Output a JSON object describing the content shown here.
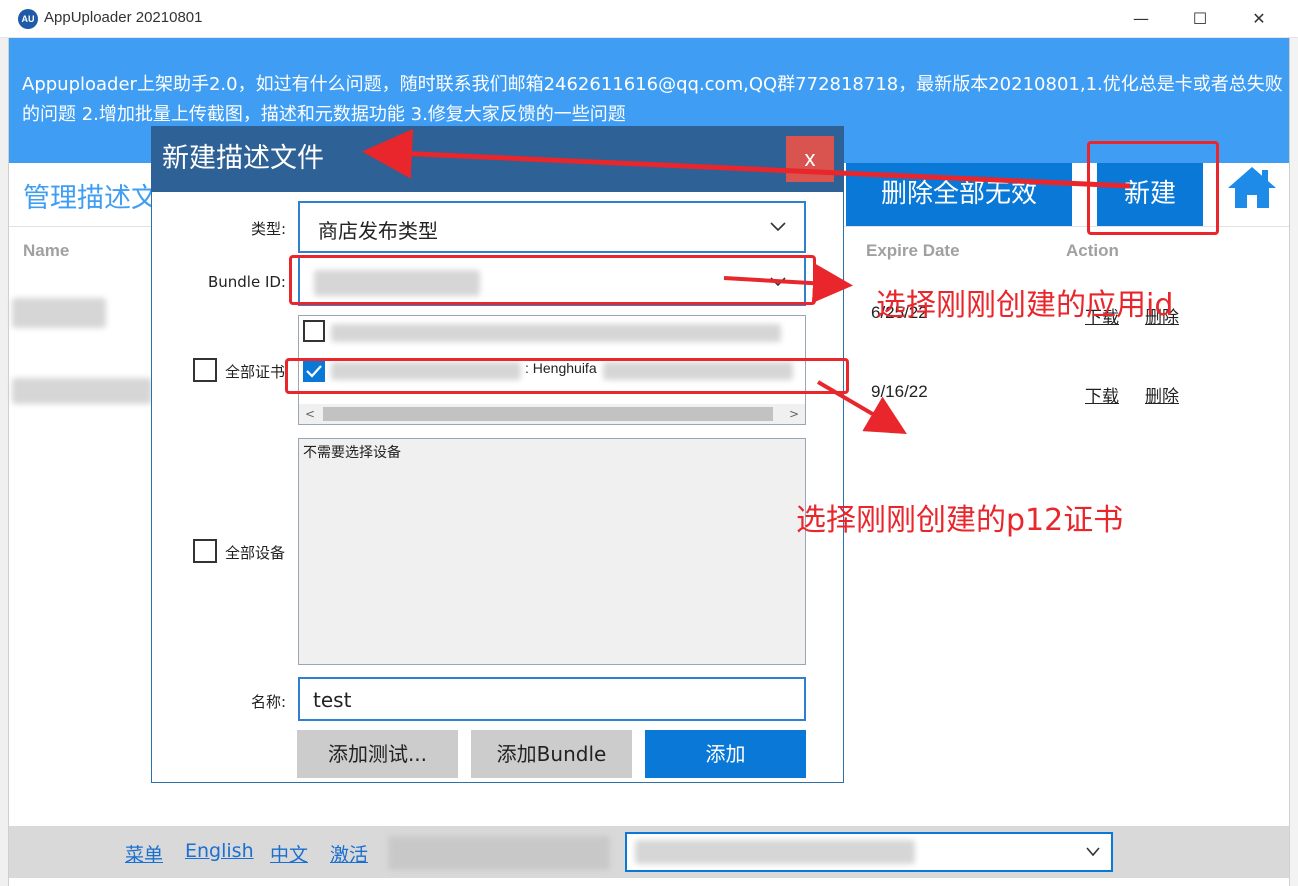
{
  "window": {
    "title": "AppUploader 20210801",
    "app_icon": "AU",
    "minimize": "—",
    "maximize": "☐",
    "close": "✕"
  },
  "banner": {
    "text": "Appuploader上架助手2.0，如过有什么问题，随时联系我们邮箱2462611616@qq.com,QQ群772818718，最新版本20210801,1.优化总是卡或者总失败的问题 2.增加批量上传截图，描述和元数据功能 3.修复大家反馈的一些问题"
  },
  "main": {
    "page_title": "管理描述文",
    "delete_invalid_label": "删除全部无效",
    "new_label": "新建",
    "home_icon": "home-icon",
    "columns": {
      "name": "Name",
      "expire": "Expire Date",
      "action": "Action"
    },
    "rows": [
      {
        "expire": "6/25/22",
        "download": "下载",
        "delete": "删除"
      },
      {
        "expire": "9/16/22",
        "download": "下载",
        "delete": "删除"
      }
    ]
  },
  "dialog": {
    "title": "新建描述文件",
    "close_label": "x",
    "type_label": "类型:",
    "type_value": "商店发布类型",
    "bundle_label": "Bundle ID:",
    "all_certs_label": "全部证书",
    "cert_item_visible": ": Henghuifa",
    "all_devices_label": "全部设备",
    "devices_placeholder": "不需要选择设备",
    "name_label": "名称:",
    "name_value": "test",
    "btn_add_test": "添加测试...",
    "btn_add_bundle": "添加Bundle",
    "btn_add": "添加"
  },
  "annotations": {
    "select_app_id": "选择刚刚创建的应用id",
    "select_p12": "选择刚刚创建的p12证书"
  },
  "footer": {
    "menu": "菜单",
    "english": "English",
    "chinese": "中文",
    "activate": "激活"
  },
  "colors": {
    "banner": "#3f9ef3",
    "accent": "#0a78d7",
    "dialog_header": "#2e6196",
    "annotation_red": "#e8262b"
  }
}
